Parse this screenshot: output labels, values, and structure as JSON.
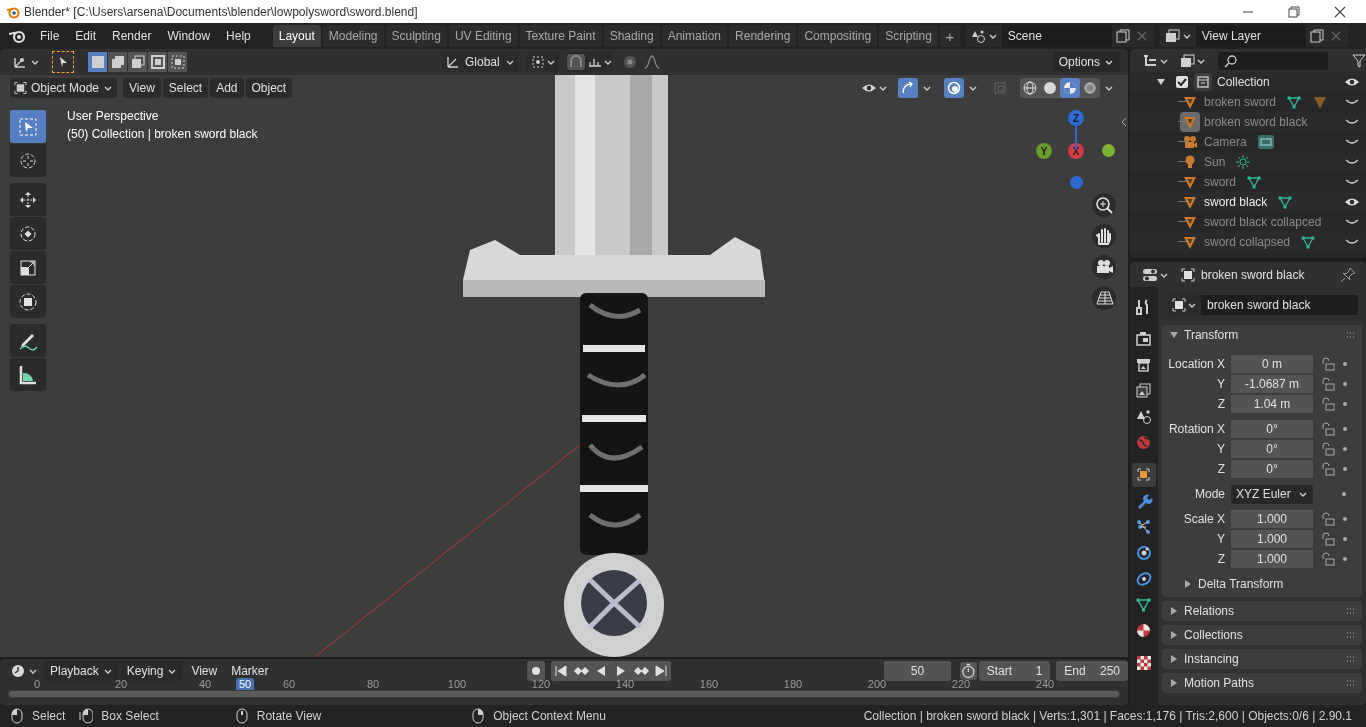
{
  "title_bar": {
    "title": "Blender* [C:\\Users\\arsena\\Documents\\blender\\lowpolysword\\sword.blend]"
  },
  "menu": [
    "File",
    "Edit",
    "Render",
    "Window",
    "Help"
  ],
  "workspaces": [
    {
      "label": "Layout",
      "selected": true
    },
    {
      "label": "Modeling",
      "selected": false
    },
    {
      "label": "Sculpting",
      "selected": false
    },
    {
      "label": "UV Editing",
      "selected": false
    },
    {
      "label": "Texture Paint",
      "selected": false
    },
    {
      "label": "Shading",
      "selected": false
    },
    {
      "label": "Animation",
      "selected": false
    },
    {
      "label": "Rendering",
      "selected": false
    },
    {
      "label": "Compositing",
      "selected": false
    },
    {
      "label": "Scripting",
      "selected": false
    }
  ],
  "add_workspace": "+",
  "scene": {
    "name": "Scene"
  },
  "view_layer": {
    "name": "View Layer"
  },
  "tool_header": {
    "orientation": "Global",
    "snap": false,
    "proportional": false,
    "options": "Options"
  },
  "viewport": {
    "mode": "Object Mode",
    "menus": [
      "View",
      "Select",
      "Add",
      "Object"
    ],
    "info": [
      "User Perspective",
      "(50) Collection | broken sword black"
    ],
    "tools": [
      {
        "kind": "select",
        "selected": true
      },
      {
        "kind": "cursor",
        "selected": false
      },
      {
        "kind": "move",
        "selected": false
      },
      {
        "kind": "rotate",
        "selected": false
      },
      {
        "kind": "scale",
        "selected": false
      },
      {
        "kind": "transform",
        "selected": false
      },
      {
        "kind": "annotate",
        "selected": false
      },
      {
        "kind": "measure",
        "selected": false
      }
    ],
    "gizmo_axes": [
      {
        "label": "Z",
        "color": "#2e6ad1"
      },
      {
        "label": "Y",
        "color": "#6a9a2a"
      },
      {
        "label": "X",
        "color": "#d63a48"
      }
    ],
    "shading_modes": [
      {
        "kind": "wireframe",
        "selected": false
      },
      {
        "kind": "solid",
        "selected": false
      },
      {
        "kind": "material",
        "selected": true
      },
      {
        "kind": "rendered",
        "selected": false
      }
    ]
  },
  "outliner": {
    "collection": {
      "name": "Collection",
      "checked": true,
      "expanded": true,
      "visible": true,
      "children": [
        {
          "name": "broken sword",
          "kind": "mesh",
          "visible": false,
          "selected": false,
          "data_icons": [
            {
              "kind": "mesh"
            },
            {
              "kind": "mesh_object"
            }
          ]
        },
        {
          "name": "broken sword black",
          "kind": "mesh",
          "visible": false,
          "selected": true
        },
        {
          "name": "Camera",
          "kind": "camera",
          "visible": false,
          "selected": false,
          "data_icons": [
            {
              "kind": "camera_data"
            }
          ]
        },
        {
          "name": "Sun",
          "kind": "light",
          "visible": false,
          "selected": false,
          "data_icons": [
            {
              "kind": "light_data"
            }
          ]
        },
        {
          "name": "sword",
          "kind": "mesh",
          "visible": false,
          "selected": false,
          "data_icons": [
            {
              "kind": "mesh"
            }
          ]
        },
        {
          "name": "sword black",
          "kind": "mesh",
          "visible": true,
          "selected": false,
          "data_icons": [
            {
              "kind": "mesh"
            }
          ]
        },
        {
          "name": "sword black collapced",
          "kind": "mesh",
          "visible": false,
          "selected": false
        },
        {
          "name": "sword collapsed",
          "kind": "mesh",
          "visible": false,
          "selected": false,
          "data_icons": [
            {
              "kind": "mesh"
            }
          ]
        }
      ]
    }
  },
  "properties": {
    "object_name": "broken sword black",
    "name_field": "broken sword black",
    "tabs": [
      {
        "kind": "tool",
        "selected": false
      },
      {
        "kind": "render",
        "selected": false
      },
      {
        "kind": "output",
        "selected": false
      },
      {
        "kind": "view_layer",
        "selected": false
      },
      {
        "kind": "scene",
        "selected": false
      },
      {
        "kind": "world",
        "selected": false
      },
      {
        "kind": "object",
        "selected": true
      },
      {
        "kind": "modifiers",
        "selected": false
      },
      {
        "kind": "particles",
        "selected": false
      },
      {
        "kind": "physics",
        "selected": false
      },
      {
        "kind": "constraints",
        "selected": false
      },
      {
        "kind": "data",
        "selected": false
      },
      {
        "kind": "material",
        "selected": false
      },
      {
        "kind": "texture",
        "selected": false
      }
    ],
    "transform": {
      "title": "Transform",
      "expanded": true,
      "groups": [
        {
          "rows": [
            {
              "kind": "field",
              "label": "Location X",
              "value": "0 m"
            },
            {
              "kind": "field",
              "label": "Y",
              "value": "-1.0687 m"
            },
            {
              "kind": "field",
              "label": "Z",
              "value": "1.04 m"
            }
          ]
        },
        {
          "rows": [
            {
              "kind": "field",
              "label": "Rotation X",
              "value": "0°"
            },
            {
              "kind": "field",
              "label": "Y",
              "value": "0°"
            },
            {
              "kind": "field",
              "label": "Z",
              "value": "0°"
            }
          ]
        },
        {
          "rows": [
            {
              "kind": "dropdown",
              "label": "Mode",
              "value": "XYZ Euler"
            }
          ]
        },
        {
          "rows": [
            {
              "kind": "field",
              "label": "Scale X",
              "value": "1.000"
            },
            {
              "kind": "field",
              "label": "Y",
              "value": "1.000"
            },
            {
              "kind": "field",
              "label": "Z",
              "value": "1.000"
            }
          ]
        }
      ],
      "subpanel": {
        "title": "Delta Transform",
        "expanded": false
      }
    },
    "panels": [
      {
        "title": "Relations",
        "expanded": false
      },
      {
        "title": "Collections",
        "expanded": false
      },
      {
        "title": "Instancing",
        "expanded": false
      },
      {
        "title": "Motion Paths",
        "expanded": false
      }
    ]
  },
  "timeline": {
    "menus": [
      "Playback",
      "Keying",
      "View",
      "Marker"
    ],
    "current_frame": "50",
    "start_label": "Start",
    "start": "1",
    "end_label": "End",
    "end": "250",
    "ruler": [
      "0",
      "20",
      "40",
      "60",
      "80",
      "100",
      "120",
      "140",
      "160",
      "180",
      "200",
      "220",
      "240"
    ],
    "ruler_current": "50"
  },
  "status_bar": {
    "hints": [
      {
        "kind": "left",
        "label": "Select"
      },
      {
        "kind": "drag",
        "label": "Box Select"
      },
      {
        "kind": "middle",
        "label": "Rotate View"
      },
      {
        "kind": "right",
        "label": "Object Context Menu"
      }
    ],
    "stats": "Collection | broken sword black | Verts:1,301 | Faces:1,176 | Tris:2,600 | Objects:0/6 | 2.90.1"
  }
}
